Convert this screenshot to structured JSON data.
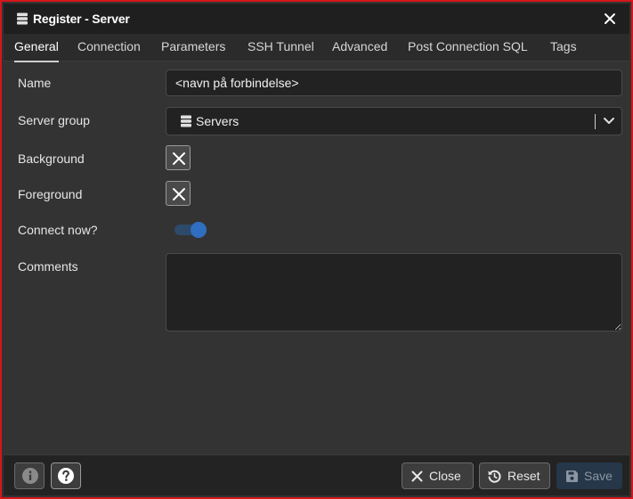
{
  "window": {
    "title": "Register - Server",
    "title_icon": "server-icon",
    "close_icon": "close-icon"
  },
  "tabs": [
    {
      "label": "General",
      "active": true
    },
    {
      "label": "Connection",
      "active": false
    },
    {
      "label": "Parameters",
      "active": false
    },
    {
      "label": "SSH Tunnel",
      "active": false
    },
    {
      "label": "Advanced",
      "active": false
    },
    {
      "label": "Post Connection SQL",
      "active": false
    },
    {
      "label": "Tags",
      "active": false
    }
  ],
  "form": {
    "name": {
      "label": "Name",
      "value": "<navn på forbindelse>"
    },
    "server_group": {
      "label": "Server group",
      "value": "Servers",
      "icon": "server-icon"
    },
    "background": {
      "label": "Background"
    },
    "foreground": {
      "label": "Foreground"
    },
    "connect_now": {
      "label": "Connect now?",
      "checked": true
    },
    "comments": {
      "label": "Comments",
      "value": ""
    }
  },
  "footer": {
    "info_icon": "info-icon",
    "help_icon": "help-icon",
    "close_label": "Close",
    "reset_label": "Reset",
    "save_label": "Save"
  },
  "colors": {
    "border": "#d4161c",
    "accent": "#2f6ec0",
    "panel": "#333333",
    "titlebar": "#1f1f1f"
  }
}
